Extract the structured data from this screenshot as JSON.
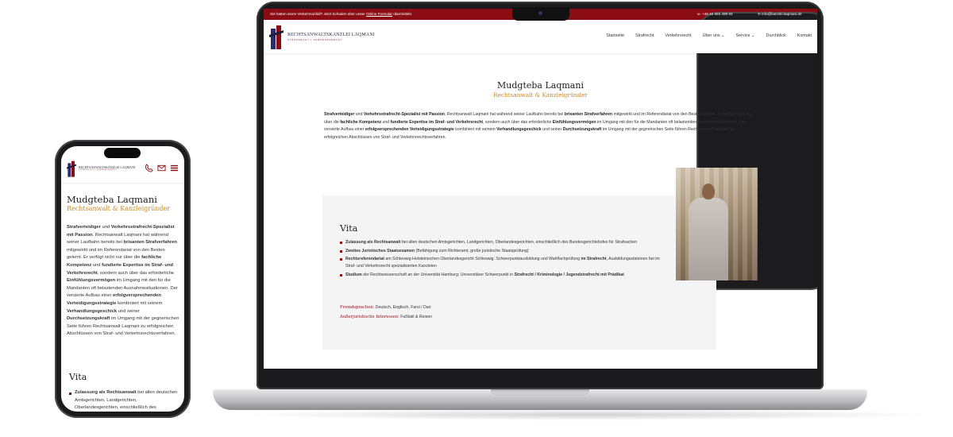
{
  "site": {
    "topbar": {
      "notice_prefix": "Sie hatten einen Verkehrsunfall? Jetzt Schaden über unser ",
      "notice_link": "Online Formular",
      "notice_suffix": " übermitteln.",
      "phone_icon": "☏",
      "phone": "+49 40 555 499 93",
      "mail_icon": "✉",
      "email": "info@kanzlei-laqmani.de"
    },
    "logo": {
      "name": "RECHTSANWALTSKANZLEI LAQMANI",
      "sub": "STRAFRECHT  |  VERKEHRSRECHT"
    },
    "nav": [
      "Startseite",
      "Strafrecht",
      "Verkehrsrecht",
      "Über uns ⌄",
      "Service ⌄",
      "Durchblick",
      "Kontakt"
    ],
    "hero": {
      "name": "Mudgteba Laqmani",
      "role": "Rechtsanwalt & Kanzleigründer"
    },
    "intro": {
      "s1": "Strafverteidiger",
      "t1": " und ",
      "s2": "Verkehrsstrafrecht-Spezialist mit Passion",
      "t2": ". Rechtsanwalt Laqmani hat während seiner Laufbahn bereits bei ",
      "s3": "brisanten Strafverfahren",
      "t3": " mitgewirkt und im Referendariat von den Besten gelernt. Er verfügt nicht nur über die ",
      "s4": "fachliche Kompetenz",
      "t4": " und ",
      "s5": "fundierte Expertise im Straf- und Verkehrsrecht",
      "t5": ", sondern auch über das erforderliche ",
      "s6": "Einfühlungsvermögen",
      "t6": " im Umgang mit den für die Mandanten oft belastenden Ausnahmesituationen.  Der versierte Aufbau einer ",
      "s7": "erfolgversprechenden Verteidigungsstrategie",
      "t7": " kombiniert mit seinem ",
      "s8": "Verhandlungsgeschick",
      "t8": " und seiner ",
      "s9": "Durchsetzungskraft",
      "t9": " im Umgang mit der gegnerischen Seite führen Rechtsanwalt Laqmani zu erfolgreichen Abschlüssen von Straf- und Verkehrsrechtsverfahren."
    },
    "vita": {
      "title": "Vita",
      "items": [
        {
          "bold": "Zulassung als Rechtsanwalt",
          "text": " bei allen deutschen Amtsgerichten, Landgerichten, Oberlandesgerichten, einschließlich des Bundesgerichtshofes für Strafsachen"
        },
        {
          "bold": "Zweites Juristisches Staatsexamen",
          "text": " (Befähigung zum Richteramt, große juristische Staatsprüfung)"
        },
        {
          "bold": "Rechtsreferendariat",
          "text": " am Schleswig-Holsteinischen Oberlandesgericht Schleswig. Schwerpunktausbildung und Wahlfachprüfung ",
          "bold2": "im Strafrecht",
          "text2": ", Ausbildungsstationen bei im Straf- und Verkehrsrecht spezialisierten Kanzleien"
        },
        {
          "bold": "Studium",
          "text": " der Rechtswissenschaft an der Universität Hamburg; Universitärer Schwerpunkt in ",
          "bold2": "Strafrecht / Kriminologie / Jugendstrafrecht mit Prädikat",
          "text2": ""
        }
      ],
      "languages_label": "Fremdsprachen:",
      "languages": " Deutsch, Englisch, Farsi / Dari",
      "interests_label": "Außerjuristische Interessen:",
      "interests": " Fußball & Reisen"
    }
  },
  "mobile": {
    "logo_name": "RECHTSANWALTSKANZLEI LAQMANI",
    "logo_sub": "STRAFRECHT  |  VERKEHRSRECHT",
    "icons": [
      "phone-icon",
      "mail-icon",
      "menu-icon"
    ],
    "vita_item_partial": "Zulassung als Rechtsanwalt",
    "vita_item_partial_text": " bei allen deutschen Amtsgerichten, Landgerichten, Oberlandesgerichten, einschließlich des"
  },
  "colors": {
    "brand_red": "#8b0d13",
    "accent_gold": "#c68a2a",
    "vita_bg": "#f4f4f4"
  }
}
